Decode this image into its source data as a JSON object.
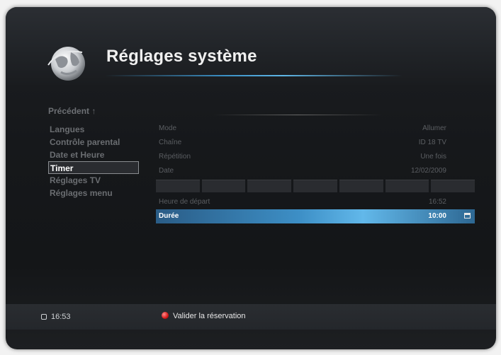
{
  "header": {
    "title": "Réglages système",
    "logo_icon": "globe-logo-icon"
  },
  "menu": {
    "back_label": "Précédent",
    "items": [
      {
        "label": "Langues"
      },
      {
        "label": "Contrôle parental"
      },
      {
        "label": "Date et Heure"
      },
      {
        "label": "Timer"
      },
      {
        "label": "Réglages TV"
      },
      {
        "label": "Réglages menu"
      }
    ],
    "active_index": 3
  },
  "timer": {
    "rows": [
      {
        "label": "Mode",
        "value": "Allumer"
      },
      {
        "label": "Chaîne",
        "value": "ID 18 TV"
      },
      {
        "label": "Répétition",
        "value": "Une fois"
      },
      {
        "label": "Date",
        "value": "12/02/2009"
      },
      {
        "label": "Heure de départ",
        "value": "16:52"
      },
      {
        "label": "Durée",
        "value": "10:00"
      }
    ],
    "selected_index": 5,
    "selected_icon": "calendar-icon"
  },
  "footer": {
    "time": "16:53",
    "clock_icon": "clock-icon",
    "action_label": "Valider la réservation",
    "action_icon": "red-button-icon",
    "accent_color": "#d41818"
  },
  "colors": {
    "highlight": "#3d8fc6",
    "background": "#16181b"
  }
}
